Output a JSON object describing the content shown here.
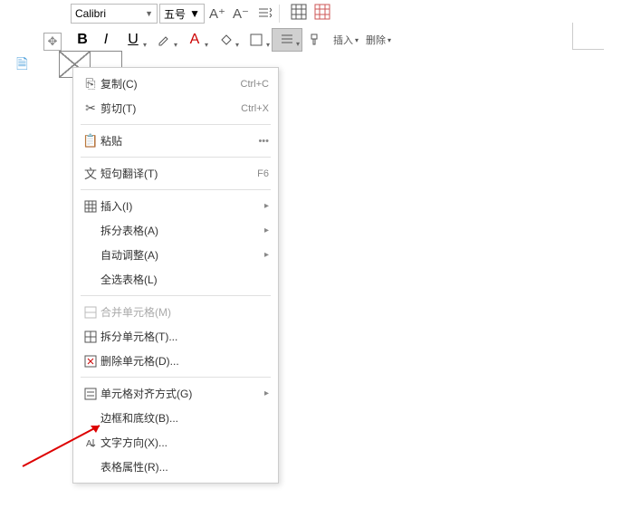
{
  "toolbar": {
    "font_name": "Calibri",
    "font_size": "五号",
    "bold": "B",
    "italic": "I",
    "underline": "U",
    "insert_label": "插入",
    "delete_label": "删除"
  },
  "context_menu": {
    "copy": {
      "label": "复制(C)",
      "shortcut": "Ctrl+C"
    },
    "cut": {
      "label": "剪切(T)",
      "shortcut": "Ctrl+X"
    },
    "paste": {
      "label": "粘贴",
      "more": "•••"
    },
    "translate": {
      "label": "短句翻译(T)",
      "shortcut": "F6"
    },
    "insert": {
      "label": "插入(I)"
    },
    "split_table": {
      "label": "拆分表格(A)"
    },
    "autofit": {
      "label": "自动调整(A)"
    },
    "select_table": {
      "label": "全选表格(L)"
    },
    "merge_cells": {
      "label": "合并单元格(M)"
    },
    "split_cells": {
      "label": "拆分单元格(T)..."
    },
    "delete_cells": {
      "label": "删除单元格(D)..."
    },
    "cell_align": {
      "label": "单元格对齐方式(G)"
    },
    "borders": {
      "label": "边框和底纹(B)..."
    },
    "text_direction": {
      "label": "文字方向(X)..."
    },
    "table_props": {
      "label": "表格属性(R)..."
    }
  }
}
